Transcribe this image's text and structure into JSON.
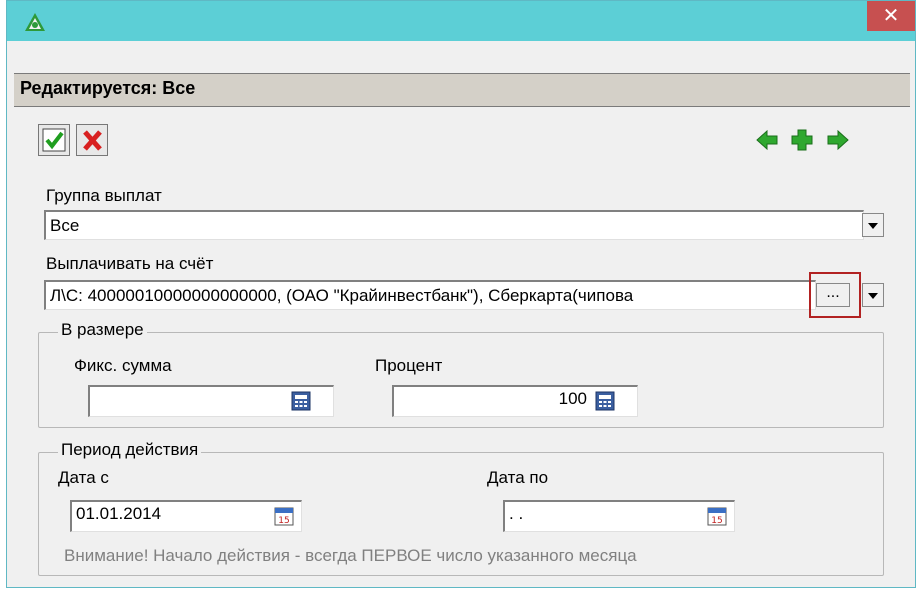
{
  "window": {
    "close_label": "✕"
  },
  "header": {
    "title": "Редактируется: Все"
  },
  "group": {
    "label": "Группа выплат",
    "value": "Все"
  },
  "account": {
    "label": "Выплачивать на счёт",
    "value": "Л\\С: 40000010000000000000, (ОАО \"Крайинвестбанк\"), Сберкарта(чипова",
    "ellipsis_label": "..."
  },
  "amount": {
    "legend": "В размере",
    "fixed_label": "Фикс. сумма",
    "fixed_value": "",
    "percent_label": "Процент",
    "percent_value": "100"
  },
  "period": {
    "legend": "Период действия",
    "from_label": "Дата с",
    "from_value": "01.01.2014",
    "to_label": "Дата по",
    "to_value": " .  .",
    "note": "Внимание! Начало действия - всегда ПЕРВОЕ число указанного месяца"
  },
  "colors": {
    "titlebar": "#5ccfd6",
    "close": "#c75050",
    "highlight": "#b22222",
    "nav_green": "#2fa82f"
  }
}
